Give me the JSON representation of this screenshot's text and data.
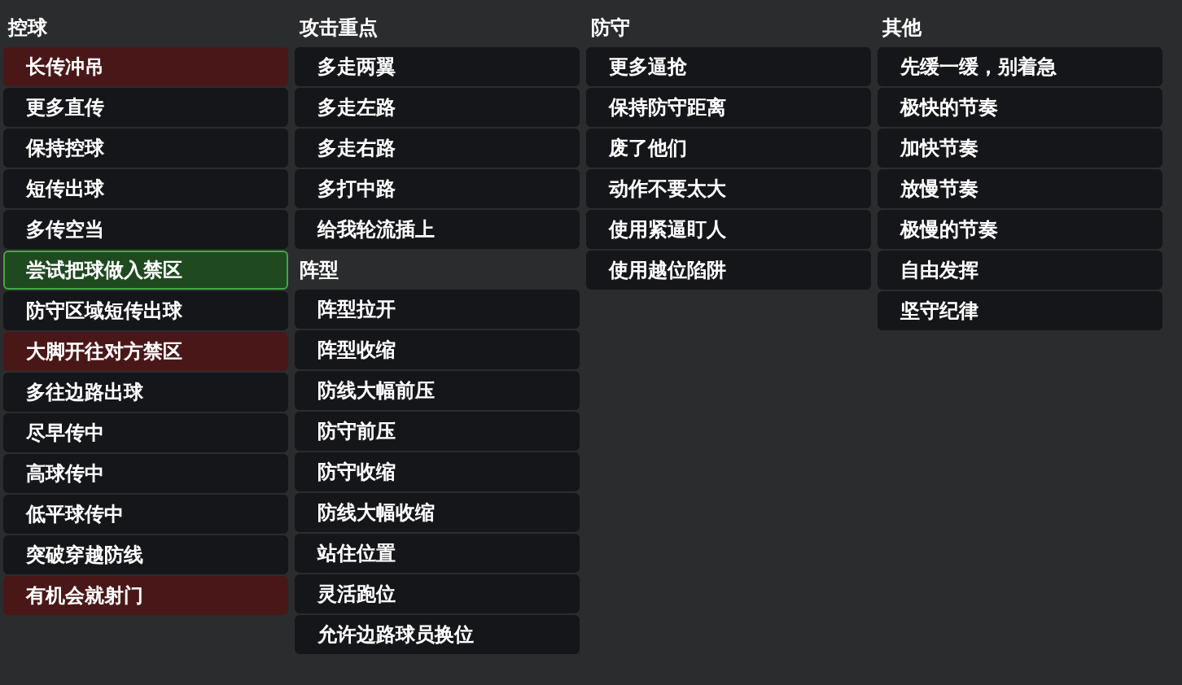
{
  "columns": [
    {
      "sections": [
        {
          "title": "控球",
          "items": [
            {
              "label": "长传冲吊",
              "kind": "flagged"
            },
            {
              "label": "更多直传",
              "kind": "plain"
            },
            {
              "label": "保持控球",
              "kind": "plain"
            },
            {
              "label": "短传出球",
              "kind": "plain"
            },
            {
              "label": "多传空当",
              "kind": "plain"
            },
            {
              "label": "尝试把球做入禁区",
              "kind": "chosen"
            },
            {
              "label": "防守区域短传出球",
              "kind": "plain"
            },
            {
              "label": "大脚开往对方禁区",
              "kind": "flagged"
            },
            {
              "label": "多往边路出球",
              "kind": "plain"
            },
            {
              "label": "尽早传中",
              "kind": "plain"
            },
            {
              "label": "高球传中",
              "kind": "plain"
            },
            {
              "label": "低平球传中",
              "kind": "plain"
            },
            {
              "label": "突破穿越防线",
              "kind": "plain"
            },
            {
              "label": "有机会就射门",
              "kind": "flagged"
            }
          ]
        }
      ]
    },
    {
      "sections": [
        {
          "title": "攻击重点",
          "items": [
            {
              "label": "多走两翼",
              "kind": "plain"
            },
            {
              "label": "多走左路",
              "kind": "plain"
            },
            {
              "label": "多走右路",
              "kind": "plain"
            },
            {
              "label": "多打中路",
              "kind": "plain"
            },
            {
              "label": "给我轮流插上",
              "kind": "plain"
            }
          ]
        },
        {
          "title": "阵型",
          "items": [
            {
              "label": "阵型拉开",
              "kind": "plain"
            },
            {
              "label": "阵型收缩",
              "kind": "plain"
            },
            {
              "label": "防线大幅前压",
              "kind": "plain"
            },
            {
              "label": "防守前压",
              "kind": "plain"
            },
            {
              "label": "防守收缩",
              "kind": "plain"
            },
            {
              "label": "防线大幅收缩",
              "kind": "plain"
            },
            {
              "label": "站住位置",
              "kind": "plain"
            },
            {
              "label": "灵活跑位",
              "kind": "plain"
            },
            {
              "label": "允许边路球员换位",
              "kind": "plain"
            }
          ]
        }
      ]
    },
    {
      "sections": [
        {
          "title": "防守",
          "items": [
            {
              "label": "更多逼抢",
              "kind": "plain"
            },
            {
              "label": "保持防守距离",
              "kind": "plain"
            },
            {
              "label": "废了他们",
              "kind": "plain"
            },
            {
              "label": "动作不要太大",
              "kind": "plain"
            },
            {
              "label": "使用紧逼盯人",
              "kind": "plain"
            },
            {
              "label": "使用越位陷阱",
              "kind": "plain"
            }
          ]
        }
      ]
    },
    {
      "sections": [
        {
          "title": "其他",
          "items": [
            {
              "label": "先缓一缓，别着急",
              "kind": "plain"
            },
            {
              "label": "极快的节奏",
              "kind": "plain"
            },
            {
              "label": "加快节奏",
              "kind": "plain"
            },
            {
              "label": "放慢节奏",
              "kind": "plain"
            },
            {
              "label": "极慢的节奏",
              "kind": "plain"
            },
            {
              "label": "自由发挥",
              "kind": "plain"
            },
            {
              "label": "坚守纪律",
              "kind": "plain"
            }
          ]
        }
      ]
    }
  ]
}
